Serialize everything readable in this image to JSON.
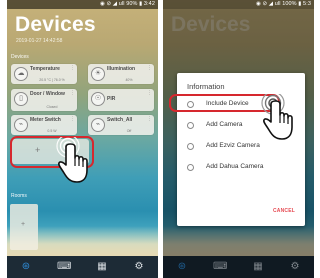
{
  "left_screen": {
    "status_bar": "◉ ⊘ ◢ ull 90% ▮ 3:42",
    "title": "Devices",
    "datetime": "2019-01-27 14:42:58",
    "devices_label": "Devices",
    "devices": [
      {
        "name": "Temperature",
        "status": "20.5 °C | 76.0 %",
        "icon": "thermometer-icon",
        "glyph": "☁"
      },
      {
        "name": "Illumination",
        "status": "40%",
        "icon": "sun-icon",
        "glyph": "☀"
      },
      {
        "name": "Door / Window",
        "status": "Closed",
        "icon": "door-icon",
        "glyph": "▯"
      },
      {
        "name": "PIR",
        "status": "",
        "icon": "motion-icon",
        "glyph": "☉"
      },
      {
        "name": "Meter Switch",
        "status": "0.5 W",
        "icon": "switch-icon",
        "glyph": "⌁"
      },
      {
        "name": "Switch_All",
        "status": "Off",
        "icon": "switch-all-icon",
        "glyph": "⌁"
      }
    ],
    "add_device_symbol": "+",
    "rooms_label": "Rooms",
    "add_room_symbol": "+"
  },
  "right_screen": {
    "status_bar": "◉ ⊘ ◢ ull 100% ▮ 5:3",
    "ghost_title": "Devices",
    "dialog": {
      "title": "Information",
      "options": [
        "Include Device",
        "Add Camera",
        "Add Ezviz Camera",
        "Add Dahua Camera"
      ],
      "cancel_label": "CANCEL"
    }
  },
  "nav_icons": [
    "wifi-signal-icon",
    "keyboard-icon",
    "network-icon",
    "settings-gear-icon"
  ],
  "colors": {
    "highlight": "#d6282e",
    "nav_bg": "#1d2b36",
    "nav_active": "#2f8bd6",
    "cancel": "#e64a52"
  }
}
